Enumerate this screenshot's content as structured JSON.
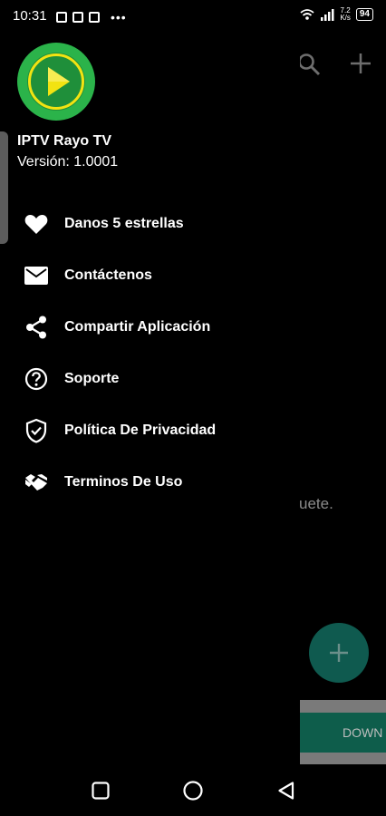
{
  "status": {
    "time": "10:31",
    "dots": "•••",
    "speed_value": "7.2",
    "speed_unit": "K/s",
    "battery": "94"
  },
  "drawer": {
    "app_name": "IPTV Rayo TV",
    "version": "Versión: 1.0001",
    "menu": [
      {
        "label": "Danos 5 estrellas",
        "icon": "heart-icon"
      },
      {
        "label": "Contáctenos",
        "icon": "envelope-icon"
      },
      {
        "label": "Compartir Aplicación",
        "icon": "share-icon"
      },
      {
        "label": "Soporte",
        "icon": "help-circle-icon"
      },
      {
        "label": "Política De Privacidad",
        "icon": "shield-check-icon"
      },
      {
        "label": "Terminos De Uso",
        "icon": "handshake-icon"
      }
    ]
  },
  "background": {
    "partial_text": "uete.",
    "download_label": "DOWN"
  },
  "colors": {
    "logo_green": "#2bb34a",
    "play_yellow": "#f2e312",
    "fab_teal": "#0f5a4f"
  }
}
